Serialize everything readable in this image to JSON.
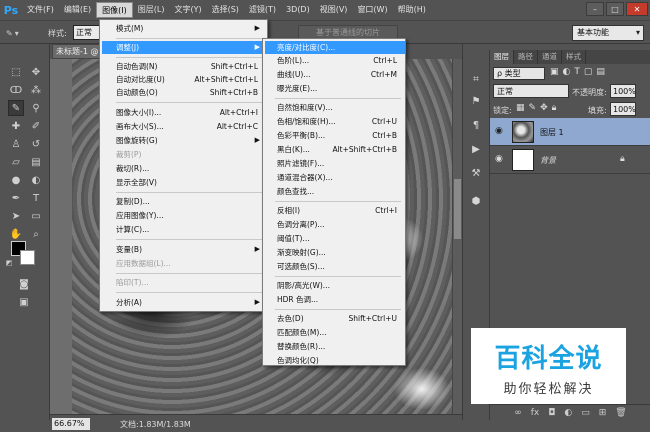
{
  "app": {
    "logo": "Ps"
  },
  "menubar": {
    "items": [
      "文件(F)",
      "编辑(E)",
      "图像(I)",
      "图层(L)",
      "文字(Y)",
      "选择(S)",
      "滤镜(T)",
      "3D(D)",
      "视图(V)",
      "窗口(W)",
      "帮助(H)"
    ],
    "active_index": 2
  },
  "window_controls": {
    "minimize": "–",
    "maximize": "□",
    "close": "✕"
  },
  "options": {
    "style_label": "样式:",
    "style_value": "正常",
    "refine_edge": "基于普通线的切片",
    "workspace": "基本功能"
  },
  "document": {
    "tab_title": "未标题-1 @",
    "zoom": "66.67%",
    "doc_info": "文档:1.83M/1.83M"
  },
  "image_menu": {
    "items": [
      {
        "label": "模式(M)",
        "shortcut": "",
        "submenu": true,
        "disabled": false,
        "highlight": false
      },
      {
        "label": "调整(J)",
        "shortcut": "",
        "submenu": true,
        "disabled": false,
        "highlight": true
      },
      {
        "label": "自动色调(N)",
        "shortcut": "Shift+Ctrl+L",
        "submenu": false,
        "disabled": false,
        "highlight": false
      },
      {
        "label": "自动对比度(U)",
        "shortcut": "Alt+Shift+Ctrl+L",
        "submenu": false,
        "disabled": false,
        "highlight": false
      },
      {
        "label": "自动颜色(O)",
        "shortcut": "Shift+Ctrl+B",
        "submenu": false,
        "disabled": false,
        "highlight": false
      },
      {
        "label": "图像大小(I)...",
        "shortcut": "Alt+Ctrl+I",
        "submenu": false,
        "disabled": false,
        "highlight": false
      },
      {
        "label": "画布大小(S)...",
        "shortcut": "Alt+Ctrl+C",
        "submenu": false,
        "disabled": false,
        "highlight": false
      },
      {
        "label": "图像旋转(G)",
        "shortcut": "",
        "submenu": true,
        "disabled": false,
        "highlight": false
      },
      {
        "label": "裁剪(P)",
        "shortcut": "",
        "submenu": false,
        "disabled": true,
        "highlight": false
      },
      {
        "label": "裁切(R)...",
        "shortcut": "",
        "submenu": false,
        "disabled": false,
        "highlight": false
      },
      {
        "label": "显示全部(V)",
        "shortcut": "",
        "submenu": false,
        "disabled": false,
        "highlight": false
      },
      {
        "label": "复制(D)...",
        "shortcut": "",
        "submenu": false,
        "disabled": false,
        "highlight": false
      },
      {
        "label": "应用图像(Y)...",
        "shortcut": "",
        "submenu": false,
        "disabled": false,
        "highlight": false
      },
      {
        "label": "计算(C)...",
        "shortcut": "",
        "submenu": false,
        "disabled": false,
        "highlight": false
      },
      {
        "label": "变量(B)",
        "shortcut": "",
        "submenu": true,
        "disabled": false,
        "highlight": false
      },
      {
        "label": "应用数据组(L)...",
        "shortcut": "",
        "submenu": false,
        "disabled": true,
        "highlight": false
      },
      {
        "label": "陷印(T)...",
        "shortcut": "",
        "submenu": false,
        "disabled": true,
        "highlight": false
      },
      {
        "label": "分析(A)",
        "shortcut": "",
        "submenu": true,
        "disabled": false,
        "highlight": false
      }
    ]
  },
  "adjust_menu": {
    "items": [
      {
        "label": "亮度/对比度(C)...",
        "shortcut": "",
        "highlight": true
      },
      {
        "label": "色阶(L)...",
        "shortcut": "Ctrl+L",
        "highlight": false
      },
      {
        "label": "曲线(U)...",
        "shortcut": "Ctrl+M",
        "highlight": false
      },
      {
        "label": "曝光度(E)...",
        "shortcut": "",
        "highlight": false
      },
      {
        "label": "自然饱和度(V)...",
        "shortcut": "",
        "highlight": false
      },
      {
        "label": "色相/饱和度(H)...",
        "shortcut": "Ctrl+U",
        "highlight": false
      },
      {
        "label": "色彩平衡(B)...",
        "shortcut": "Ctrl+B",
        "highlight": false
      },
      {
        "label": "黑白(K)...",
        "shortcut": "Alt+Shift+Ctrl+B",
        "highlight": false
      },
      {
        "label": "照片滤镜(F)...",
        "shortcut": "",
        "highlight": false
      },
      {
        "label": "通道混合器(X)...",
        "shortcut": "",
        "highlight": false
      },
      {
        "label": "颜色查找...",
        "shortcut": "",
        "highlight": false
      },
      {
        "label": "反相(I)",
        "shortcut": "Ctrl+I",
        "highlight": false
      },
      {
        "label": "色调分离(P)...",
        "shortcut": "",
        "highlight": false
      },
      {
        "label": "阈值(T)...",
        "shortcut": "",
        "highlight": false
      },
      {
        "label": "渐变映射(G)...",
        "shortcut": "",
        "highlight": false
      },
      {
        "label": "可选颜色(S)...",
        "shortcut": "",
        "highlight": false
      },
      {
        "label": "阴影/高光(W)...",
        "shortcut": "",
        "highlight": false
      },
      {
        "label": "HDR 色调...",
        "shortcut": "",
        "highlight": false
      },
      {
        "label": "去色(D)",
        "shortcut": "Shift+Ctrl+U",
        "highlight": false
      },
      {
        "label": "匹配颜色(M)...",
        "shortcut": "",
        "highlight": false
      },
      {
        "label": "替换颜色(R)...",
        "shortcut": "",
        "highlight": false
      },
      {
        "label": "色调均化(Q)",
        "shortcut": "",
        "highlight": false
      }
    ]
  },
  "layers_panel": {
    "tabs": [
      "图层",
      "路径",
      "通道",
      "样式"
    ],
    "filter_label": "ρ 类型",
    "blend_mode": "正常",
    "opacity_label": "不透明度:",
    "opacity_value": "100%",
    "lock_label": "锁定:",
    "fill_label": "填充:",
    "fill_value": "100%",
    "layers": [
      {
        "name": "图层 1",
        "selected": true,
        "locked": false
      },
      {
        "name": "背景",
        "selected": false,
        "locked": true
      }
    ],
    "bottom_icons": [
      "link-icon",
      "fx-icon",
      "mask-icon",
      "adjustment-icon",
      "folder-icon",
      "new-layer-icon",
      "trash-icon"
    ]
  },
  "watermark": {
    "title": "百科全说",
    "subtitle": "助你轻松解决"
  },
  "colors": {
    "accent": "#3399ff",
    "panel": "#535353",
    "menu_bg": "#f0f0f0",
    "layer_selected": "#8fa8d0",
    "watermark_blue": "#1aa3e0"
  }
}
